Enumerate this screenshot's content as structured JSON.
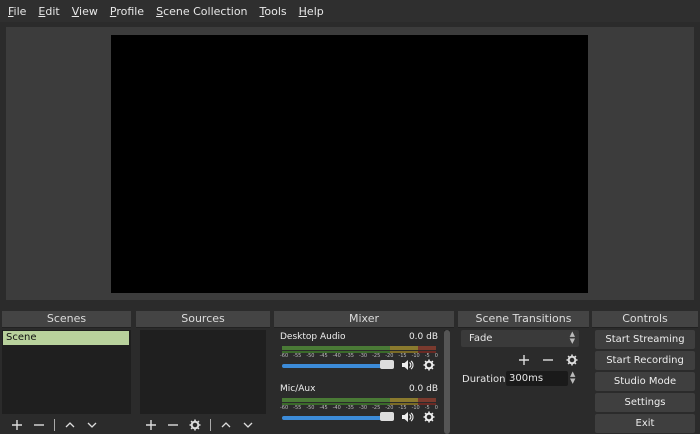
{
  "menu": {
    "items": [
      "File",
      "Edit",
      "View",
      "Profile",
      "Scene Collection",
      "Tools",
      "Help"
    ],
    "underline": [
      "F",
      "E",
      "V",
      "P",
      "S",
      "T",
      "H"
    ]
  },
  "docks": {
    "scenes": {
      "title": "Scenes",
      "items": [
        "Scene"
      ]
    },
    "sources": {
      "title": "Sources"
    },
    "mixer": {
      "title": "Mixer",
      "ticks": [
        "-60",
        "-55",
        "-50",
        "-45",
        "-40",
        "-35",
        "-30",
        "-25",
        "-20",
        "-15",
        "-10",
        "-5",
        "0"
      ],
      "channels": [
        {
          "name": "Desktop Audio",
          "db": "0.0 dB"
        },
        {
          "name": "Mic/Aux",
          "db": "0.0 dB"
        }
      ]
    },
    "transitions": {
      "title": "Scene Transitions",
      "selected": "Fade",
      "duration_label": "Duration",
      "duration_value": "300ms"
    },
    "controls": {
      "title": "Controls",
      "buttons": [
        "Start Streaming",
        "Start Recording",
        "Studio Mode",
        "Settings",
        "Exit"
      ]
    }
  },
  "colors": {
    "selected_scene": "#b8d19c",
    "volume_slider": "#3c8bd8"
  }
}
